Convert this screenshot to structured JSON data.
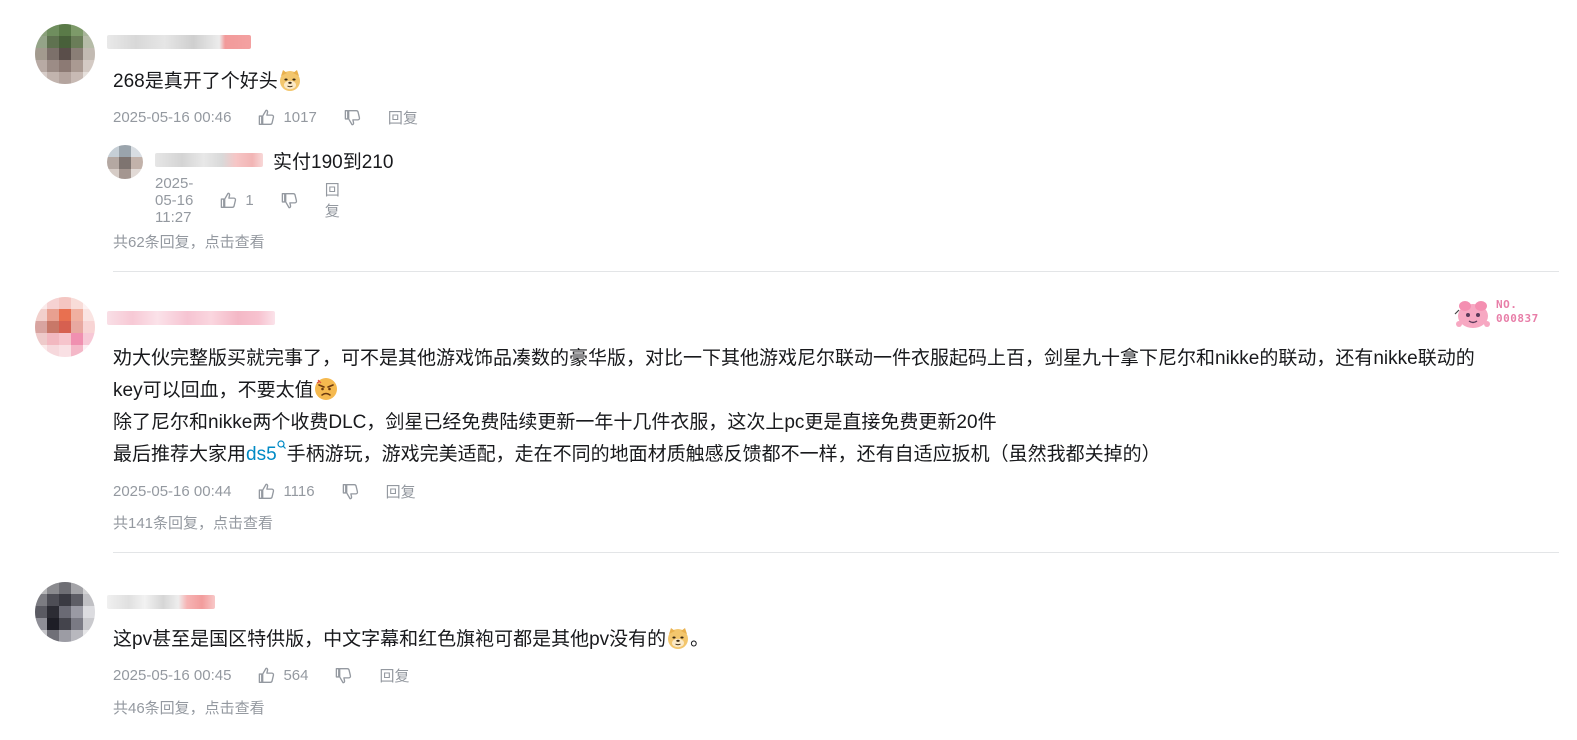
{
  "comments": [
    {
      "content_line1": "268是真开了个好头",
      "time": "2025-05-16 00:46",
      "likes": "1017",
      "reply_label": "回复",
      "more_replies": "共62条回复，点击查看",
      "sub_reply": {
        "text": "实付190到210",
        "time": "2025-05-16 11:27",
        "likes": "1",
        "reply_label": "回复"
      }
    },
    {
      "content_line1": "劝大伙完整版买就完事了，可不是其他游戏饰品凑数的豪华版，对比一下其他游戏尼尔联动一件衣服起码上百，剑星九十拿下尼尔和nikke的联动，还有nikke联动的",
      "content_line2": "key可以回血，不要太值",
      "content_line3": "除了尼尔和nikke两个收费DLC，剑星已经免费陆续更新一年十几件衣服，这次上pc更是直接免费更新20件",
      "content_line4_prefix": "最后推荐大家用",
      "content_line4_link": "ds5",
      "content_line4_suffix": "手柄游玩，游戏完美适配，走在不同的地面材质触感反馈都不一样，还有自适应扳机（虽然我都关掉的）",
      "badge": "NO.\n000837",
      "time": "2025-05-16 00:44",
      "likes": "1116",
      "reply_label": "回复",
      "more_replies": "共141条回复，点击查看"
    },
    {
      "content_line1": "这pv甚至是国区特供版，中文字幕和红色旗袍可都是其他pv没有的",
      "content_suffix": "。",
      "time": "2025-05-16 00:45",
      "likes": "564",
      "reply_label": "回复",
      "more_replies": "共46条回复，点击查看"
    }
  ],
  "icons": {
    "like": "thumbs-up-icon",
    "dislike": "thumbs-down-icon",
    "emoji_doge": "doge-emoji-icon",
    "emoji_angry": "angry-emoji-icon",
    "link_search": "search-link-icon"
  },
  "colors": {
    "text": "#18191c",
    "meta": "#9499a0",
    "link": "#008ac5",
    "divider": "#e3e5e7",
    "badge": "#e87ea8"
  }
}
